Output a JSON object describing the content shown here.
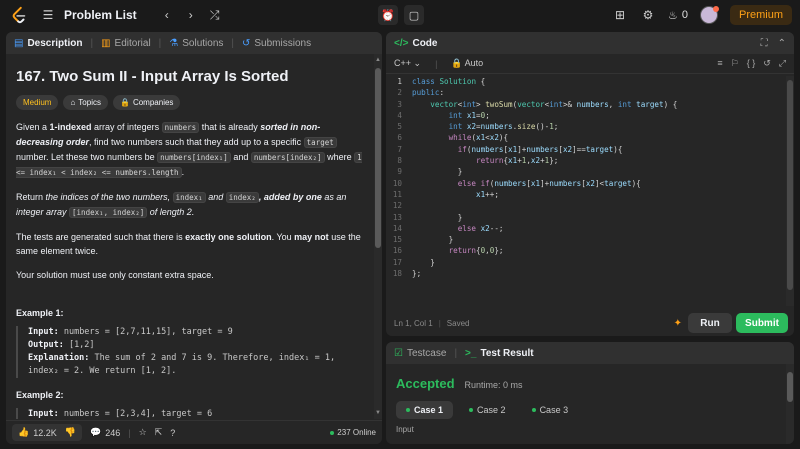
{
  "topbar": {
    "title": "Problem List",
    "streak_count": "0",
    "premium_label": "Premium"
  },
  "left_panel": {
    "tabs": [
      {
        "label": "Description"
      },
      {
        "label": "Editorial"
      },
      {
        "label": "Solutions"
      },
      {
        "label": "Submissions"
      }
    ],
    "problem_title": "167. Two Sum II - Input Array Is Sorted",
    "tags": {
      "difficulty": "Medium",
      "topics": "Topics",
      "companies": "Companies"
    },
    "para1": {
      "a": "Given a ",
      "b": "1-indexed",
      "c": " array of integers ",
      "d": "numbers",
      "e": " that is already ",
      "f": "sorted in non-decreasing order",
      "g": ", find two numbers such that they add up to a specific ",
      "h": "target",
      "i": " number. Let these two numbers be ",
      "j": "numbers[index₁]",
      "k": " and ",
      "l": "numbers[index₂]",
      "m": " where ",
      "n": "1 <= index₁ < index₂ <= numbers.length",
      "o": "."
    },
    "para2": {
      "a": "Return ",
      "b": "the indices of the two numbers, ",
      "c": "index₁",
      "d": " and ",
      "e": "index₂",
      "f": ", added by one",
      "g": " as an integer array ",
      "h": "[index₁, index₂]",
      "i": " of length 2."
    },
    "para3": {
      "a": "The tests are generated such that there is ",
      "b": "exactly one solution",
      "c": ". You ",
      "d": "may not",
      "e": " use the same element twice."
    },
    "para4": "Your solution must use only constant extra space.",
    "example1": {
      "title": "Example 1:",
      "input_label": "Input:",
      "input": " numbers = [2,7,11,15], target = 9",
      "output_label": "Output:",
      "output": " [1,2]",
      "expl_label": "Explanation:",
      "expl1": " The sum of 2 and 7 is 9. Therefore, index₁ = 1,",
      "expl2": "index₂ = 2. We return [1, 2]."
    },
    "example2": {
      "title": "Example 2:",
      "input_label": "Input:",
      "input": " numbers = [2,3,4], target = 6"
    },
    "footer": {
      "likes": "12.2K",
      "comments": "246",
      "online": "237 Online"
    }
  },
  "code_panel": {
    "title": "Code",
    "language": "C++",
    "auto": "Auto",
    "status": "Ln 1, Col 1",
    "saved": "Saved",
    "run_label": "Run",
    "submit_label": "Submit",
    "line_numbers": [
      "1",
      "2",
      "3",
      "4",
      "5",
      "6",
      "7",
      "8",
      "9",
      "10",
      "11",
      "12",
      "13",
      "14",
      "15",
      "16",
      "17",
      "18"
    ]
  },
  "result_panel": {
    "tabs": [
      {
        "label": "Testcase"
      },
      {
        "label": "Test Result"
      }
    ],
    "verdict": "Accepted",
    "runtime": "Runtime: 0 ms",
    "cases": [
      {
        "label": "Case 1"
      },
      {
        "label": "Case 2"
      },
      {
        "label": "Case 3"
      }
    ],
    "input_label": "Input"
  },
  "colors": {
    "accent": "#ffa116",
    "success": "#2cbb5d",
    "bg": "#1a1a1a",
    "panel": "#262626"
  }
}
